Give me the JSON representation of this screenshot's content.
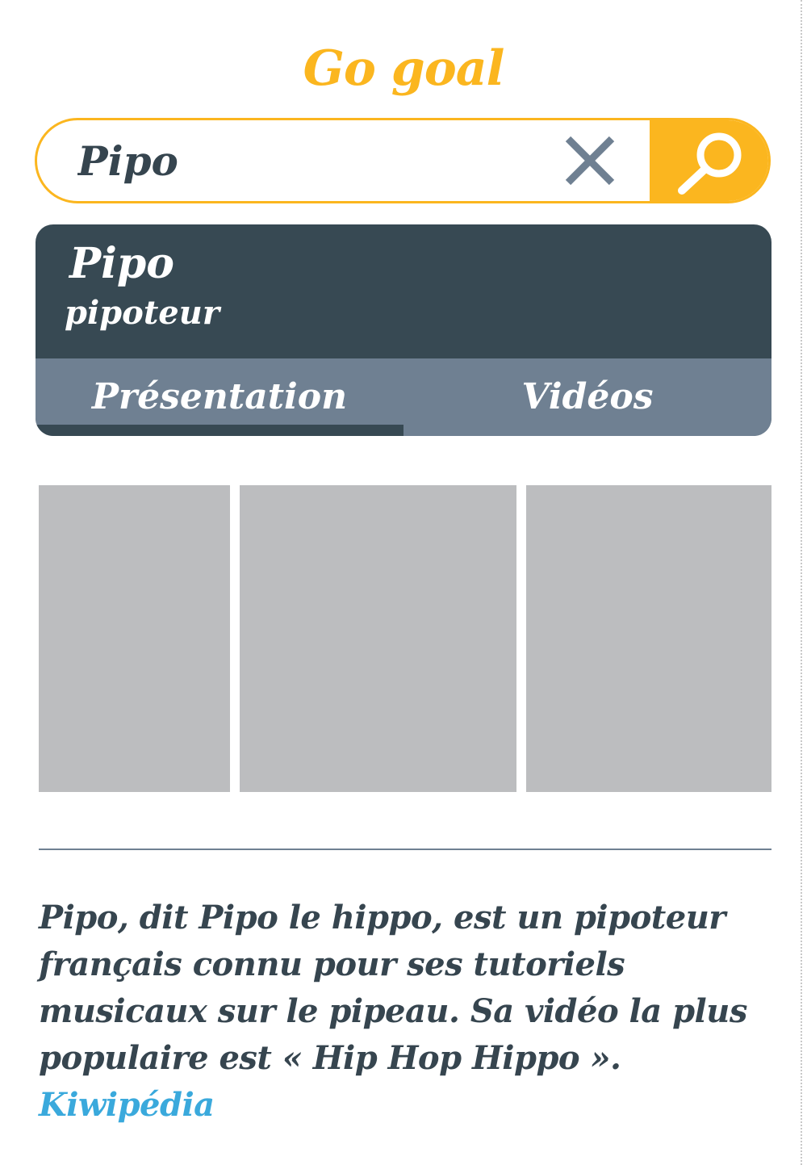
{
  "app": {
    "logo": "Go goal"
  },
  "search": {
    "query": "Pipo",
    "clear_icon": "close-icon",
    "search_icon": "search-icon"
  },
  "result": {
    "title": "Pipo",
    "subtitle": "pipoteur",
    "tabs": [
      {
        "label": "Présentation",
        "active": true
      },
      {
        "label": "Vidéos",
        "active": false
      }
    ]
  },
  "description": {
    "text": "Pipo, dit Pipo le hippo, est un pipoteur français connu pour ses tutoriels musicaux sur le pipeau. Sa vidéo la plus populaire est « Hip Hop Hippo ».",
    "source_label": "Kiwipédia"
  },
  "colors": {
    "accent": "#fbb61f",
    "card_dark": "#374953",
    "tab_bar": "#6f8092",
    "text": "#36454f",
    "link": "#3aa9dc",
    "thumbnail": "#bcbdbf"
  }
}
